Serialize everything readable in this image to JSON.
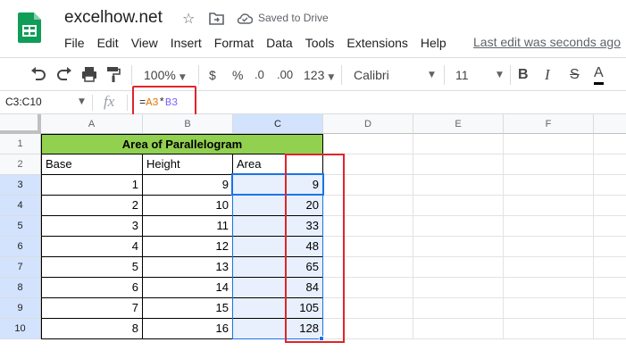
{
  "app": {
    "title": "excelhow.net",
    "save_status": "Saved to Drive",
    "last_edit": "Last edit was seconds ago",
    "accent_color": "#1a73e8",
    "logo_color": "#0f9d58"
  },
  "menu": [
    "File",
    "Edit",
    "View",
    "Insert",
    "Format",
    "Data",
    "Tools",
    "Extensions",
    "Help"
  ],
  "toolbar": {
    "zoom": "100%",
    "currency": "$",
    "percent": "%",
    "decrease_decimal": ".0",
    "increase_decimal": ".00",
    "more_formats": "123",
    "font": "Calibri",
    "font_size": "11",
    "bold": "B",
    "italic": "I",
    "strikethrough": "S",
    "text_color": "A",
    "icons": [
      "undo-icon",
      "redo-icon",
      "print-icon",
      "paint-format-icon"
    ]
  },
  "formula_bar": {
    "name_box": "C3:C10",
    "fx": "fx",
    "formula_eq": "=",
    "formula_ref1": "A3",
    "formula_op": "*",
    "formula_ref2": "B3"
  },
  "grid": {
    "columns": [
      "A",
      "B",
      "C",
      "D",
      "E",
      "F"
    ],
    "rows": [
      "1",
      "2",
      "3",
      "4",
      "5",
      "6",
      "7",
      "8",
      "9",
      "10"
    ],
    "title": "Area of Parallelogram",
    "title_color": "#92d050",
    "headers": [
      "Base",
      "Height",
      "Area"
    ],
    "data": [
      [
        "1",
        "9",
        "9"
      ],
      [
        "2",
        "10",
        "20"
      ],
      [
        "3",
        "11",
        "33"
      ],
      [
        "4",
        "12",
        "48"
      ],
      [
        "5",
        "13",
        "65"
      ],
      [
        "6",
        "14",
        "84"
      ],
      [
        "7",
        "15",
        "105"
      ],
      [
        "8",
        "16",
        "128"
      ]
    ]
  }
}
